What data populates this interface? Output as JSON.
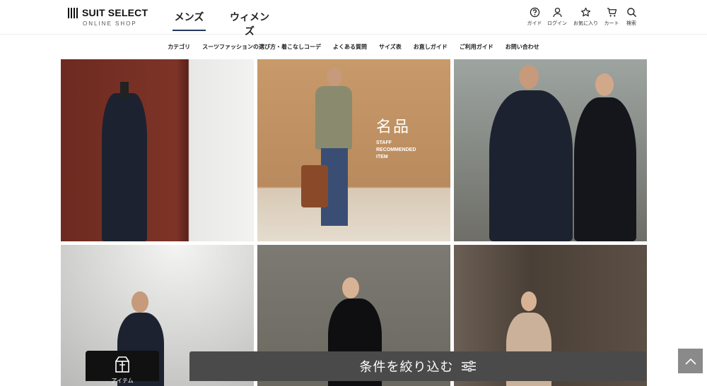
{
  "brand": {
    "name": "SUIT SELECT",
    "sub": "ONLINE SHOP"
  },
  "gender_tabs": [
    {
      "label": "メンズ",
      "active": true
    },
    {
      "label": "ウィメンズ",
      "active": false
    }
  ],
  "utility": [
    {
      "label": "ガイド",
      "icon": "help-circle-icon"
    },
    {
      "label": "ログイン",
      "icon": "user-icon"
    },
    {
      "label": "お気に入り",
      "icon": "star-icon"
    },
    {
      "label": "カート",
      "icon": "cart-icon"
    },
    {
      "label": "検索",
      "icon": "search-icon"
    }
  ],
  "subnav": [
    "カテゴリ",
    "スーツファッションの選び方・着こなしコーデ",
    "よくある質問",
    "サイズ表",
    "お直しガイド",
    "ご利用ガイド",
    "お問い合わせ"
  ],
  "promo": {
    "kanji": "名品",
    "line1": "STAFF",
    "line2": "RECOMMENDED",
    "line3": "ITEM"
  },
  "floating_button": {
    "label": "アイテム",
    "icon": "gift-box-icon"
  },
  "filter_bar": {
    "label": "条件を絞り込む",
    "icon": "filter-sliders-icon"
  },
  "colors": {
    "accent": "#23375e",
    "filter_bg": "#4a4a4a"
  }
}
